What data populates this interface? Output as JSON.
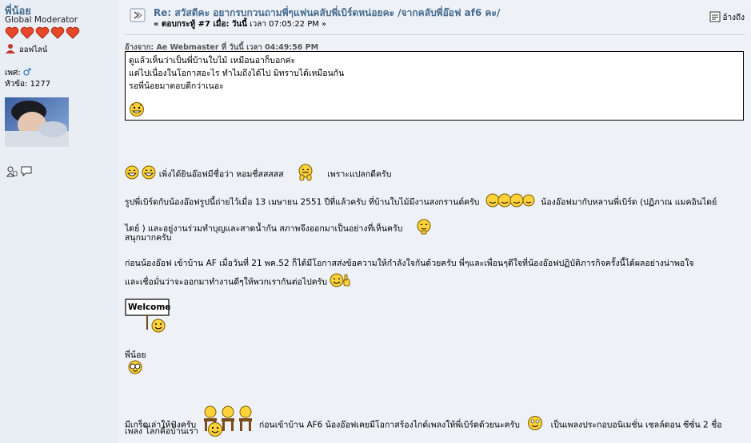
{
  "poster": {
    "username": "พี่น้อย",
    "role": "Global Moderator",
    "status": "ออฟไลน์",
    "gender_label": "เพศ:",
    "posts_label": "หัวข้อ:",
    "posts_count": "1277"
  },
  "post": {
    "title": "Re: สวัสดีคะ อยากรบกวนถามพี่ๆแฟนคลับพี่เบิร์ดหน่อยคะ /จากคลับพี่อ๊อฟ af6 คะ/",
    "reply_prefix": "« ตอบกระทู้ #7 เมื่อ:",
    "reply_when": "วันนี้",
    "reply_time": "เวลา 07:05:22 PM »",
    "quote_button": "อ้างถึง",
    "quote_header": "อ้างจาก: Ae Webmaster ที่ วันนี้ เวลา 04:49:56 PM",
    "quote_lines": [
      "ดูแล้วเห็นว่าเป็นพี่บ้านใบไม้ เหมือนอาก็บอกค่ะ",
      "แต่ไปเนื่องในโอกาสอะไร ทำไมถึงได้ไป มิทราบได้เหมือนกัน",
      "รอพี่น้อยมาตอบดีกว่าเนอะ"
    ],
    "body": {
      "l1a": "เพิ่งได้ยินอ๊อฟมีชื่อว่า หอมชื่สสสสส",
      "l1b": "เพราะแปลกดีครับ",
      "l2a": "รูปพี่เบิร์ดกับน้องอ๊อฟรูปนี้ถ่ายไว้เมื่อ 13 เมษายน 2551 ปีที่แล้วครับ ที่บ้านใบไม้มีงานสงกรานต์ครับ",
      "l2b": "น้องอ๊อฟมากับหลานพี่เบิร์ด (ปฏิภาณ แมคอินไดย์",
      "l3": "ไดย์ ) และอยู่งานร่วมทำบุญและสาดน้ำกัน สภาพจึงออกมาเป็นอย่างที่เห็นครับ",
      "l4": "สนุกมากครับ",
      "l5": "ก่อนน้องอ๊อฟ เข้าบ้าน AF เมื่อวันที่ 21 พค.52 ก็ได้มีโอกาสส่งข้อความให้กำลังใจกันด้วยครับ พี่ๆและเพื่อนๆดีใจที่น้องอ๊อฟปฏิบัติภารกิจครั้งนี้ได้ผลอย่างน่าพอใจ",
      "l6": "และเชื่อมั่นว่าจะออกมาทำงานดีๆให้พวกเรากันต่อไปครับ",
      "welcome_sign": "Welcome",
      "signature": "พี่น้อย",
      "l7a": "มีเกร็ดเล่าให้ฟังครับ",
      "l7b": "ก่อนเข้าบ้าน AF6 น้องอ๊อฟเคยมีโอกาสร้องไกด์เพลงให้พี่เบิร์ดด้วยนะครับ",
      "l7c": "เป็นเพลงประกอบอนิเมชั่น เชลล์ดอน ซีซั่น 2 ชื่อ",
      "l8": "เพลง โลกคือบ้านเรา"
    }
  },
  "colors": {
    "link": "#476c8e",
    "background": "#eef2f7",
    "heart": "#e8482a"
  }
}
